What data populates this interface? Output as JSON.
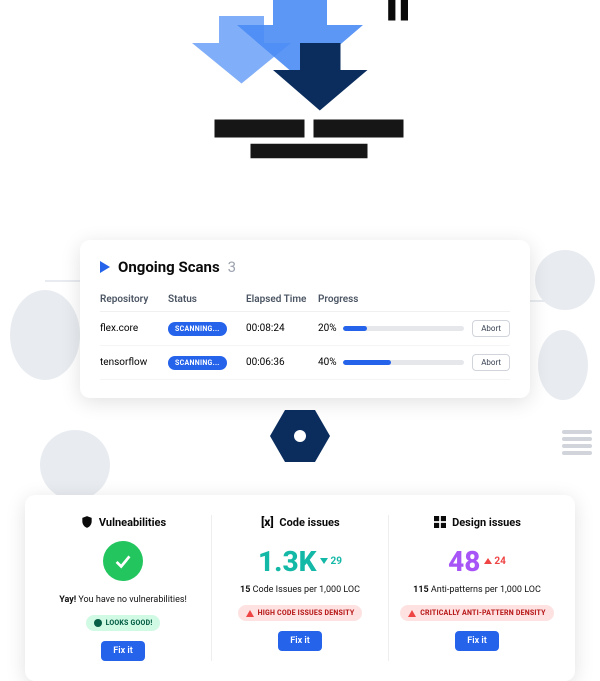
{
  "scans": {
    "title": "Ongoing Scans",
    "count": "3",
    "headers": {
      "repo": "Repository",
      "status": "Status",
      "time": "Elapsed Time",
      "progress": "Progress"
    },
    "rows": [
      {
        "repo": "flex.core",
        "status": "SCANNING...",
        "time": "00:08:24",
        "pct": "20%",
        "fill": 20,
        "abort": "Abort"
      },
      {
        "repo": "tensorflow",
        "status": "SCANNING...",
        "time": "00:06:36",
        "pct": "40%",
        "fill": 40,
        "abort": "Abort"
      }
    ]
  },
  "metrics": {
    "vuln": {
      "title": "Vulneabilities",
      "msg_bold": "Yay!",
      "msg_rest": " You have no vulnerabilities!",
      "badge": "LOOKS GOOD!",
      "fix": "Fix it"
    },
    "code": {
      "title": "Code issues",
      "value": "1.3K",
      "delta": "29",
      "sub_bold": "15",
      "sub_rest": " Code Issues per 1,000 LOC",
      "badge": "HIGH CODE ISSUES DENSITY",
      "fix": "Fix it"
    },
    "design": {
      "title": "Design issues",
      "value": "48",
      "delta": "24",
      "sub_bold": "115",
      "sub_rest": " Anti-patterns per 1,000 LOC",
      "badge": "CRITICALLY ANTI-PATTERN DENSITY",
      "fix": "Fix it"
    }
  }
}
